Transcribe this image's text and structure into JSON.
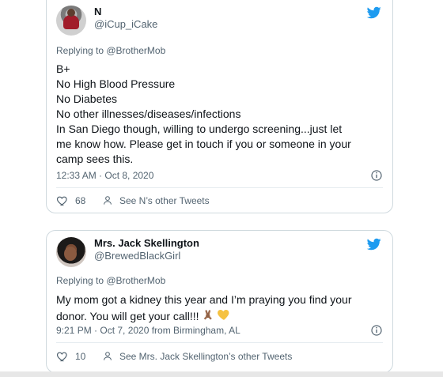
{
  "tweets": [
    {
      "display_name": "N",
      "handle": "@iCup_iCake",
      "replying_to": "Replying to @BrotherMob",
      "body_lines": [
        "B+",
        "No High Blood Pressure",
        "No Diabetes",
        "No other illnesses/diseases/infections",
        "In San Diego though, willing to undergo screening...just let",
        "me know how. Please get in touch if you or someone in your",
        "camp sees this."
      ],
      "timestamp": "12:33 AM · Oct 8, 2020",
      "likes": "68",
      "other_tweets_label": "See N’s other Tweets"
    },
    {
      "display_name": "Mrs. Jack Skellington",
      "handle": "@BrewedBlackGirl",
      "replying_to": "Replying to @BrotherMob",
      "body_lines": [
        "My mom got a kidney this year and I’m praying you find your",
        "donor. You will get your call!!!"
      ],
      "timestamp": "9:21 PM · Oct 7, 2020 from Birmingham, AL",
      "likes": "10",
      "other_tweets_label": "See Mrs. Jack Skellington’s other Tweets"
    }
  ],
  "icons": {
    "brand": "twitter-bird-icon",
    "info": "info-icon",
    "like": "heart-icon",
    "profile": "person-icon",
    "emoji_1": "folded-hands-icon",
    "emoji_2": "yellow-heart-icon"
  },
  "colors": {
    "twitter_blue": "#1d9bf0",
    "text_primary": "#0f1419",
    "text_secondary": "#536471",
    "border": "#cfd9de",
    "divider": "#e6ecf0"
  }
}
